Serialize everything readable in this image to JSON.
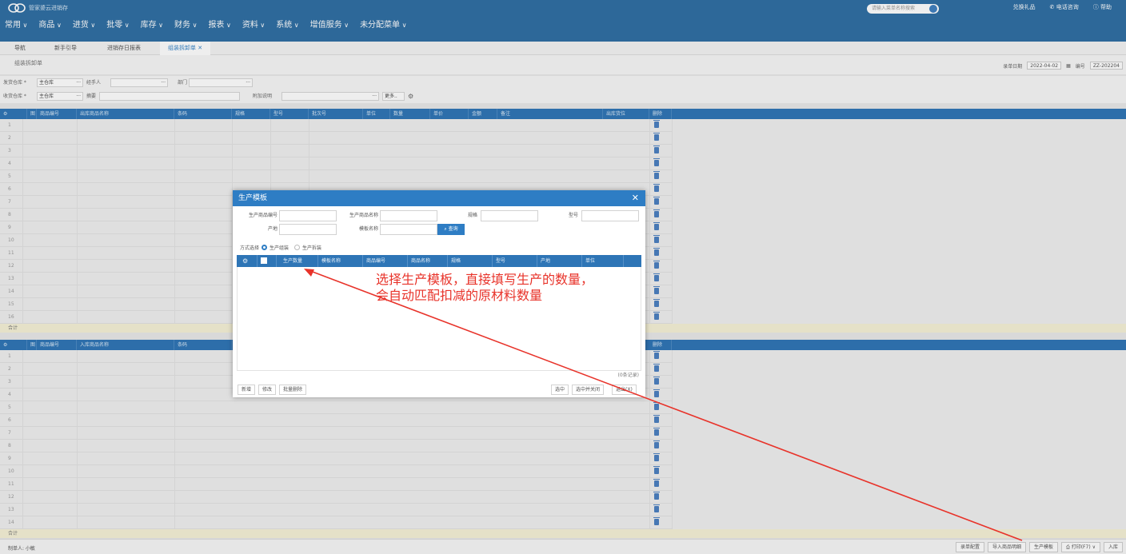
{
  "app": {
    "title": "管家婆云进销存"
  },
  "topsearch": {
    "placeholder": "请输入菜单名称搜索"
  },
  "topright": {
    "gift": "兑换礼品",
    "phone": "电话咨询",
    "help": "帮助"
  },
  "menu": [
    "常用",
    "商品",
    "进货",
    "批零",
    "库存",
    "财务",
    "报表",
    "资料",
    "系统",
    "增值服务",
    "未分配菜单"
  ],
  "tabs": [
    {
      "label": "导航"
    },
    {
      "label": "新手引导"
    },
    {
      "label": "进销存日报表"
    },
    {
      "label": "组装拆卸单"
    }
  ],
  "page": {
    "title": "组装拆卸单",
    "date_label": "录单日期",
    "date_value": "2022-04-02",
    "no_label": "编号",
    "no_value": "ZZ-202204"
  },
  "form": {
    "send_wh_label": "发货仓库 *",
    "send_wh_value": "主仓库",
    "handler_label": "经手人",
    "dept_label": "部门",
    "recv_wh_label": "收货仓库 *",
    "recv_wh_value": "主仓库",
    "summary_label": "摘要",
    "note_label": "附加说明",
    "more_label": "更多.."
  },
  "grid_out": {
    "headers": [
      "图",
      "商品编号",
      "出库商品名称",
      "条码",
      "规格",
      "型号",
      "批次号",
      "单位",
      "数量",
      "单价",
      "金额",
      "备注",
      "出库货位",
      "删除"
    ],
    "rows": [
      "1",
      "2",
      "3",
      "4",
      "5",
      "6",
      "7",
      "8",
      "9",
      "10",
      "11",
      "12",
      "13",
      "14",
      "15",
      "16"
    ],
    "sum_label": "合计"
  },
  "grid_in": {
    "headers": [
      "图",
      "商品编号",
      "入库商品名称",
      "条码",
      "删除"
    ],
    "rows": [
      "1",
      "2",
      "3",
      "4",
      "5",
      "6",
      "7",
      "8",
      "9",
      "10",
      "11",
      "12",
      "13",
      "14"
    ],
    "sum_label": "合计"
  },
  "bottom": {
    "maker_label": "制单人: 小敏",
    "buttons": [
      "录单配置",
      "导入商品明细",
      "生产模板",
      "打印(F7)",
      "入库"
    ]
  },
  "dialog": {
    "title": "生产模板",
    "fields": {
      "prod_code": "生产商品编号",
      "prod_name": "生产商品名称",
      "spec": "规格",
      "model": "型号",
      "origin": "产地",
      "tpl_name": "模板名称"
    },
    "query_btn": "查询",
    "mode_label": "方式选择",
    "mode_assemble": "生产组装",
    "mode_disassemble": "生产拆装",
    "headers": [
      "生产数量",
      "模板名称",
      "商品编号",
      "商品名称",
      "规格",
      "型号",
      "产地",
      "单位"
    ],
    "count": "(0条记录)",
    "buttons": {
      "add": "新增",
      "edit": "修改",
      "batch_delete": "批量删除",
      "select": "选中",
      "select_close": "选中并关闭",
      "exit": "退出(X)"
    }
  },
  "annotation": {
    "line1": "选择生产模板，直接填写生产的数量，",
    "line2": "会自动匹配扣减的原材料数量",
    "color": "#e8332a"
  }
}
